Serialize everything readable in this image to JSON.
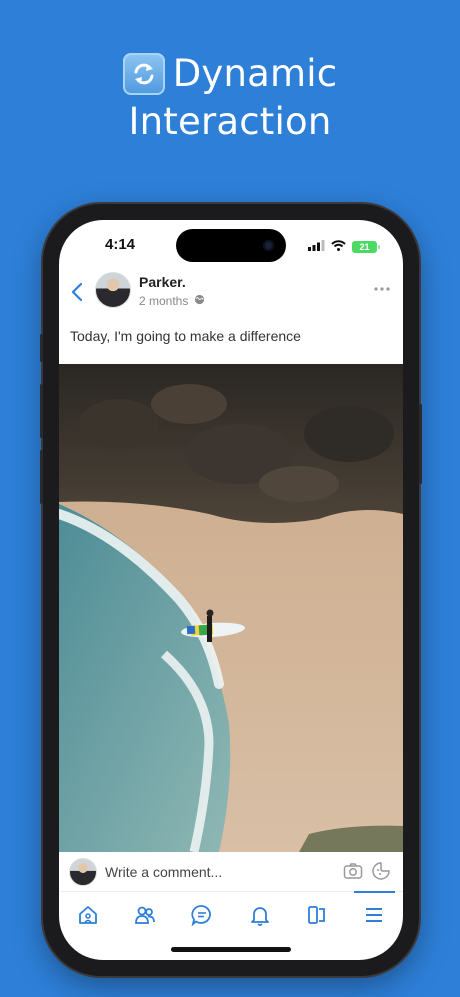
{
  "banner": {
    "emoji_icon": "refresh-emoji-icon",
    "title_line1": "Dynamic",
    "title_line2": "Interaction"
  },
  "status_bar": {
    "time": "4:14",
    "battery": "21"
  },
  "post": {
    "author": "Parker",
    "author_suffix": ".",
    "timestamp": "2 months",
    "privacy_icon": "globe-icon",
    "caption": "Today, I'm going to make a difference",
    "photo_description": "surfer-on-beach"
  },
  "comment_bar": {
    "placeholder": "Write a comment..."
  },
  "tabbar": {
    "items": [
      {
        "icon": "home-icon"
      },
      {
        "icon": "friends-icon"
      },
      {
        "icon": "messages-icon"
      },
      {
        "icon": "notifications-icon"
      },
      {
        "icon": "pages-icon"
      },
      {
        "icon": "menu-icon",
        "active": true
      }
    ]
  },
  "colors": {
    "background": "#2d7fd8",
    "accent": "#2d7fd8"
  }
}
